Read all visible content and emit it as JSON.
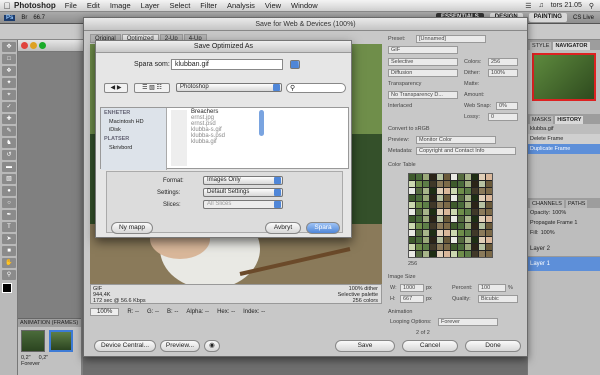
{
  "menubar": {
    "app": "Photoshop",
    "items": [
      "File",
      "Edit",
      "Image",
      "Layer",
      "Select",
      "Filter",
      "Analysis",
      "View",
      "Window"
    ],
    "tray": [
      "tors 21.05"
    ]
  },
  "psbar": {
    "zoom": "66.7",
    "workspaces": [
      "ESSENTIALS",
      "DESIGN",
      "PAINTING"
    ],
    "live": "CS Live"
  },
  "sfw": {
    "title": "Save for Web & Devices (100%)",
    "tabs": [
      "Original",
      "Optimized",
      "2-Up",
      "4-Up"
    ],
    "info": {
      "format": "GIF",
      "size": "944,4K",
      "time": "172 sec @ 56.6 Kbps",
      "dither": "100% dither",
      "palette": "Selective palette",
      "colors": "256 colors"
    },
    "zoom": "100%",
    "readouts": [
      "R: --",
      "G: --",
      "B: --",
      "Alpha: --",
      "Hex: --",
      "Index: --"
    ],
    "buttons": {
      "device_central": "Device Central...",
      "preview": "Preview...",
      "save": "Save",
      "cancel": "Cancel",
      "done": "Done"
    },
    "settings": {
      "preset_label": "Preset:",
      "preset": "[Unnamed]",
      "format": "GIF",
      "reduction": "Selective",
      "dither_algo": "Diffusion",
      "transparency": "Transparency",
      "no_trans_dither": "No Transparency D...",
      "interlaced": "Interlaced",
      "colors_label": "Colors:",
      "colors": "256",
      "dither_label": "Dither:",
      "dither": "100%",
      "matte_label": "Matte:",
      "amount_label": "Amount:",
      "websnap_label": "Web Snap:",
      "websnap": "0%",
      "lossy_label": "Lossy:",
      "lossy": "0",
      "convert": "Convert to sRGB",
      "preview_label": "Preview:",
      "preview": "Monitor Color",
      "metadata_label": "Metadata:",
      "metadata": "Copyright and Contact Info",
      "color_table": "Color Table",
      "ct_count": "256",
      "image_size": "Image Size",
      "w_label": "W:",
      "w": "1000",
      "h_label": "H:",
      "h": "667",
      "px": "px",
      "percent_label": "Percent:",
      "percent": "100",
      "pct": "%",
      "quality_label": "Quality:",
      "quality": "Bicubic",
      "animation": "Animation",
      "looping_label": "Looping Options:",
      "looping": "Forever",
      "frame": "2 of 2"
    }
  },
  "dialog": {
    "title": "Save Optimized As",
    "saveas_label": "Spara som:",
    "filename": "klubban.gif",
    "location": "Photoshop",
    "sidebar_headers": [
      "ENHETER",
      "PLATSER"
    ],
    "devices": [
      "Macintosh HD",
      "iDisk"
    ],
    "places": [
      "Skrivbord"
    ],
    "files": [
      "Breachers",
      "ernst.jpg",
      "ernst.psd",
      "klubba-s.gif",
      "klubba-s.psd",
      "klubba.gif"
    ],
    "format_label": "Format:",
    "format": "Images Only",
    "settings_label": "Settings:",
    "settings": "Default Settings",
    "slices_label": "Slices:",
    "slices": "All Slices",
    "new_folder": "Ny mapp",
    "cancel": "Avbryt",
    "save": "Spara"
  },
  "right": {
    "nav_tabs": [
      "STYLE",
      "NAVIGATOR"
    ],
    "hist_tabs": [
      "MASKS",
      "HISTORY"
    ],
    "hist_doc": "klubba.gif",
    "hist_items": [
      "Delete Frame",
      "Duplicate Frame"
    ],
    "layer_tabs": [
      "CHANNELS",
      "PATHS"
    ],
    "opacity_label": "Opacity:",
    "opacity": "100%",
    "propagate": "Propagate Frame 1",
    "fill_label": "Fill:",
    "fill": "100%",
    "layers": [
      "Layer 2",
      "Layer 1"
    ]
  },
  "anim": {
    "title": "ANIMATION (FRAMES)",
    "delay": "0,2\"",
    "loop": "Forever"
  }
}
